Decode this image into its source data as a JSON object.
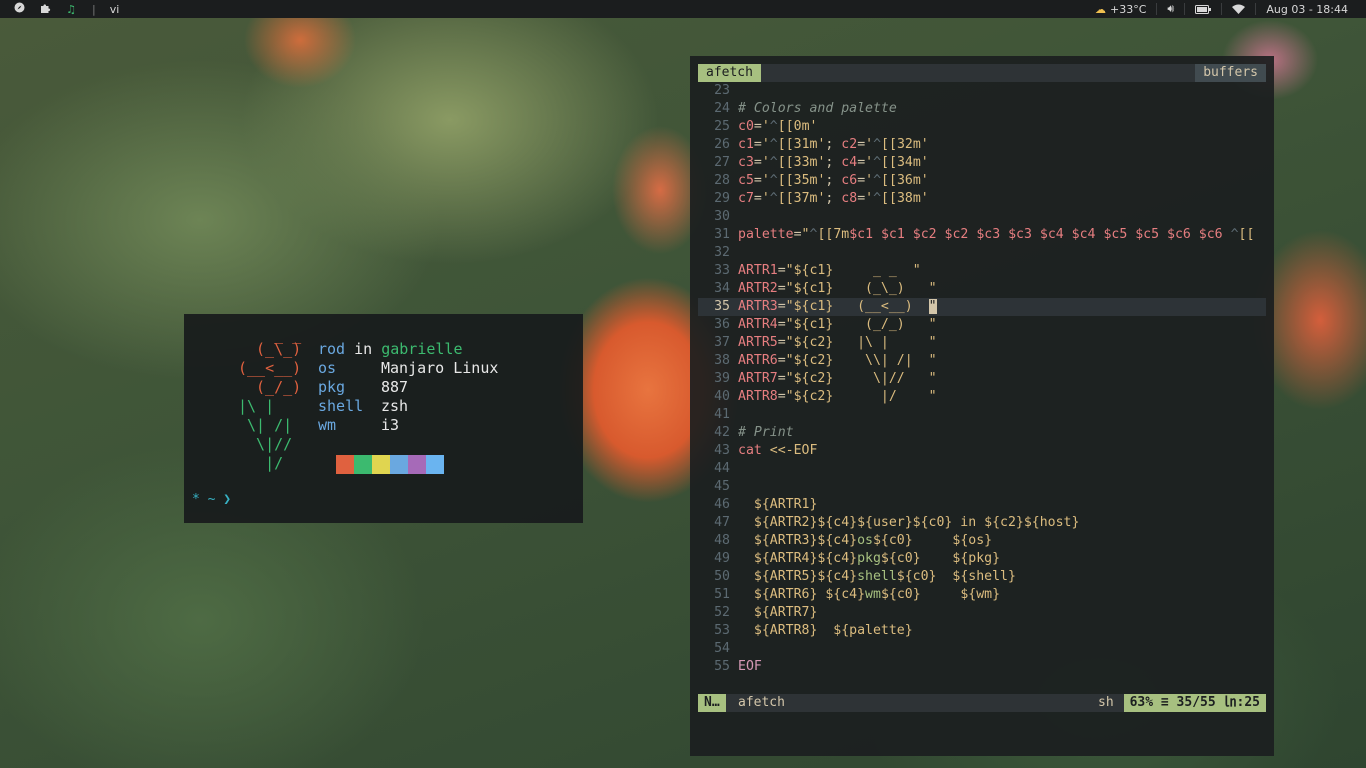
{
  "topbar": {
    "left_icons": [
      "compass-icon",
      "puzzle-icon",
      "music-note-icon"
    ],
    "workspace": "vi",
    "temperature": "+33°C",
    "date_time": "Aug 03 - 18:44",
    "colors": {
      "bg": "#1b1d1e",
      "music": "#3cba6f"
    }
  },
  "terminal": {
    "info": [
      {
        "key": "rod",
        "mid": "in",
        "val": "gabrielle"
      },
      {
        "key": "os",
        "val": "Manjaro Linux"
      },
      {
        "key": "pkg",
        "val": "887"
      },
      {
        "key": "shell",
        "val": "zsh"
      },
      {
        "key": "wm",
        "val": "i3"
      }
    ],
    "art": [
      "  _ _",
      " (_\\_)",
      "(__<__)",
      " (_/_)",
      "|\\ |",
      " \\| /|",
      "  \\|//",
      "   |/"
    ],
    "palette": [
      "#e0613f",
      "#3cba6f",
      "#e0d550",
      "#6aa8e0",
      "#a66ab8",
      "#6ab4f0"
    ],
    "prompt": "* ~ ❯"
  },
  "editor": {
    "tab_active": "afetch",
    "tab_buffers": "buffers",
    "lines": [
      {
        "n": "23",
        "t": ""
      },
      {
        "n": "24",
        "t": "# Colors and palette"
      },
      {
        "n": "25",
        "t": "c0='^[[0m'"
      },
      {
        "n": "26",
        "t": "c1='^[[31m'; c2='^[[32m'"
      },
      {
        "n": "27",
        "t": "c3='^[[33m'; c4='^[[34m'"
      },
      {
        "n": "28",
        "t": "c5='^[[35m'; c6='^[[36m'"
      },
      {
        "n": "29",
        "t": "c7='^[[37m'; c8='^[[38m'"
      },
      {
        "n": "30",
        "t": ""
      },
      {
        "n": "31",
        "t": "palette=\"^[[7m$c1 $c1 $c2 $c2 $c3 $c3 $c4 $c4 $c5 $c5 $c6 $c6 ^[["
      },
      {
        "n": "32",
        "t": ""
      },
      {
        "n": "33",
        "t": "ARTR1=\"${c1}     _ _  \""
      },
      {
        "n": "34",
        "t": "ARTR2=\"${c1}    (_\\_)   \""
      },
      {
        "n": "35",
        "t": "ARTR3=\"${c1}   (__<__)  \""
      },
      {
        "n": "36",
        "t": "ARTR4=\"${c1}    (_/_)   \""
      },
      {
        "n": "37",
        "t": "ARTR5=\"${c2}   |\\ |     \""
      },
      {
        "n": "38",
        "t": "ARTR6=\"${c2}    \\\\| /|  \""
      },
      {
        "n": "39",
        "t": "ARTR7=\"${c2}     \\|//   \""
      },
      {
        "n": "40",
        "t": "ARTR8=\"${c2}      |/    \""
      },
      {
        "n": "41",
        "t": ""
      },
      {
        "n": "42",
        "t": "# Print"
      },
      {
        "n": "43",
        "t": "cat <<-EOF"
      },
      {
        "n": "44",
        "t": ""
      },
      {
        "n": "45",
        "t": ""
      },
      {
        "n": "46",
        "t": "  ${ARTR1}"
      },
      {
        "n": "47",
        "t": "  ${ARTR2}${c4}${user}${c0} in ${c2}${host}"
      },
      {
        "n": "48",
        "t": "  ${ARTR3}${c4}os${c0}     ${os}"
      },
      {
        "n": "49",
        "t": "  ${ARTR4}${c4}pkg${c0}    ${pkg}"
      },
      {
        "n": "50",
        "t": "  ${ARTR5}${c4}shell${c0}  ${shell}"
      },
      {
        "n": "51",
        "t": "  ${ARTR6} ${c4}wm${c0}     ${wm}"
      },
      {
        "n": "52",
        "t": "  ${ARTR7}"
      },
      {
        "n": "53",
        "t": "  ${ARTR8}  ${palette}"
      },
      {
        "n": "54",
        "t": ""
      },
      {
        "n": "55",
        "t": "EOF"
      }
    ],
    "status": {
      "mode": "N…",
      "file": "afetch",
      "filetype": "sh",
      "percent": "63%",
      "position": "35/55",
      "column": ":25"
    }
  }
}
